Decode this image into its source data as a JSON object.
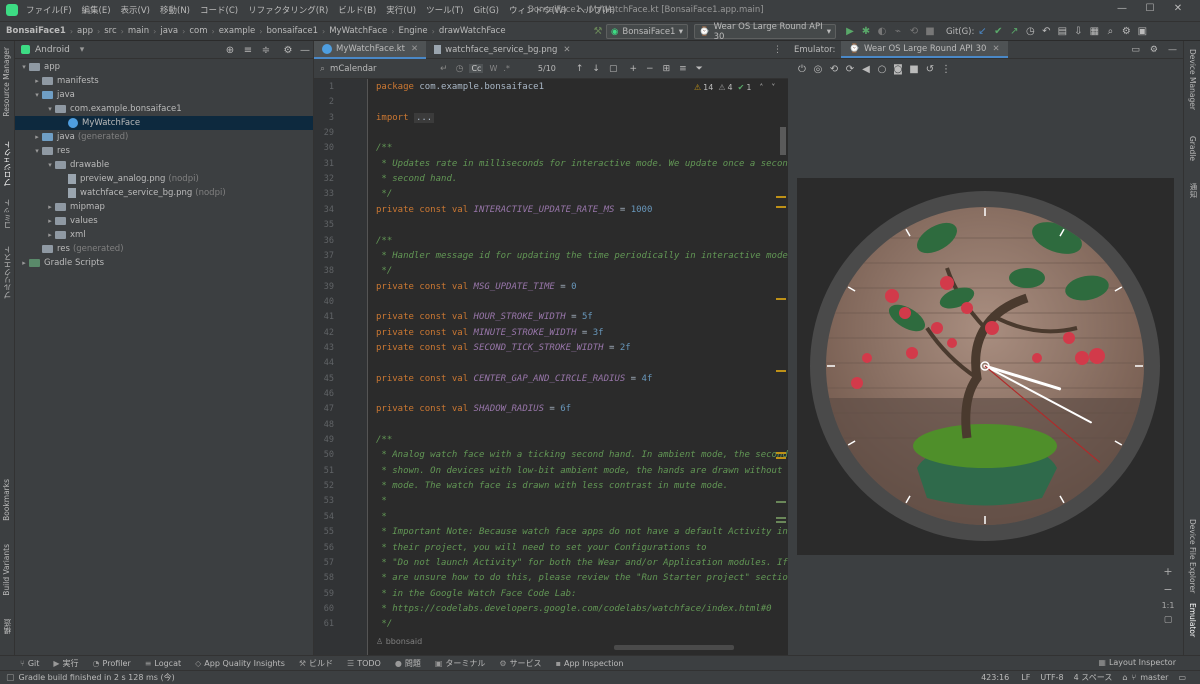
{
  "titlebar": {
    "menu": [
      "ファイル(F)",
      "編集(E)",
      "表示(V)",
      "移動(N)",
      "コード(C)",
      "リファクタリング(R)",
      "ビルド(B)",
      "実行(U)",
      "ツール(T)",
      "Git(G)",
      "ウィンドウ(W)",
      "ヘルプ(H)"
    ],
    "window_title": "BonsaiFace1 - MyWatchFace.kt [BonsaiFace1.app.main]"
  },
  "navbar": {
    "breadcrumbs": [
      "BonsaiFace1",
      "app",
      "src",
      "main",
      "java",
      "com",
      "example",
      "bonsaiface1",
      "MyWatchFace",
      "Engine",
      "drawWatchFace"
    ],
    "run_config": "BonsaiFace1",
    "device": "Wear OS Large Round API 30",
    "git_label": "Git(G):"
  },
  "leftstrip": {
    "items": [
      "Resource Manager",
      "プロジェクト",
      "コミット",
      "プルリクエスト",
      "Bookmarks",
      "Build Variants",
      "構造"
    ]
  },
  "rightstrip": {
    "items": [
      "Device Manager",
      "Gradle",
      "通知",
      "Device File Explorer",
      "Emulator"
    ]
  },
  "project": {
    "view": "Android",
    "tree": [
      {
        "label": "app",
        "suffix": "",
        "indent": 0,
        "arrow": "▾",
        "kind": "folder"
      },
      {
        "label": "manifests",
        "suffix": "",
        "indent": 1,
        "arrow": "▸",
        "kind": "folder"
      },
      {
        "label": "java",
        "suffix": "",
        "indent": 1,
        "arrow": "▾",
        "kind": "folder-blue"
      },
      {
        "label": "com.example.bonsaiface1",
        "suffix": "",
        "indent": 2,
        "arrow": "▾",
        "kind": "folder"
      },
      {
        "label": "MyWatchFace",
        "suffix": "",
        "indent": 3,
        "arrow": "",
        "kind": "kt",
        "selected": true
      },
      {
        "label": "java",
        "suffix": "(generated)",
        "indent": 1,
        "arrow": "▸",
        "kind": "folder-blue"
      },
      {
        "label": "res",
        "suffix": "",
        "indent": 1,
        "arrow": "▾",
        "kind": "folder"
      },
      {
        "label": "drawable",
        "suffix": "",
        "indent": 2,
        "arrow": "▾",
        "kind": "folder"
      },
      {
        "label": "preview_analog.png",
        "suffix": "(nodpi)",
        "indent": 3,
        "arrow": "",
        "kind": "file"
      },
      {
        "label": "watchface_service_bg.png",
        "suffix": "(nodpi)",
        "indent": 3,
        "arrow": "",
        "kind": "file"
      },
      {
        "label": "mipmap",
        "suffix": "",
        "indent": 2,
        "arrow": "▸",
        "kind": "folder"
      },
      {
        "label": "values",
        "suffix": "",
        "indent": 2,
        "arrow": "▸",
        "kind": "folder"
      },
      {
        "label": "xml",
        "suffix": "",
        "indent": 2,
        "arrow": "▸",
        "kind": "folder"
      },
      {
        "label": "res",
        "suffix": "(generated)",
        "indent": 1,
        "arrow": "",
        "kind": "folder"
      },
      {
        "label": "Gradle Scripts",
        "suffix": "",
        "indent": 0,
        "arrow": "▸",
        "kind": "gradle"
      }
    ]
  },
  "editor": {
    "tabs": [
      {
        "label": "MyWatchFace.kt",
        "active": true
      },
      {
        "label": "watchface_service_bg.png",
        "active": false
      }
    ],
    "search": {
      "value": "mCalendar",
      "count": "5/10",
      "cc": "Cc",
      "w": "W"
    },
    "inspections": {
      "warnings": "14",
      "weak": "4",
      "ok": "1"
    },
    "author_hint": "bbonsaid",
    "lines": [
      {
        "n": "1",
        "parts": [
          [
            "kw",
            "package "
          ],
          [
            "pl",
            "com.example.bonsaiface1"
          ]
        ]
      },
      {
        "n": "2",
        "parts": []
      },
      {
        "n": "3",
        "parts": [
          [
            "kw",
            "import "
          ],
          [
            "fd",
            "..."
          ]
        ]
      },
      {
        "n": "29",
        "parts": []
      },
      {
        "n": "30",
        "parts": [
          [
            "cm",
            "/**"
          ]
        ]
      },
      {
        "n": "31",
        "parts": [
          [
            "cm",
            " * Updates rate in milliseconds for interactive mode. We update once a second to advance the"
          ]
        ]
      },
      {
        "n": "32",
        "parts": [
          [
            "cm",
            " * second hand."
          ]
        ]
      },
      {
        "n": "33",
        "parts": [
          [
            "cm",
            " */"
          ]
        ]
      },
      {
        "n": "34",
        "parts": [
          [
            "kw",
            "private const val "
          ],
          [
            "cn",
            "INTERACTIVE_UPDATE_RATE_MS"
          ],
          [
            "pl",
            " = "
          ],
          [
            "num",
            "1000"
          ]
        ]
      },
      {
        "n": "35",
        "parts": []
      },
      {
        "n": "36",
        "parts": [
          [
            "cm",
            "/**"
          ]
        ]
      },
      {
        "n": "37",
        "parts": [
          [
            "cm",
            " * Handler message id for updating the time periodically in interactive mode."
          ]
        ]
      },
      {
        "n": "38",
        "parts": [
          [
            "cm",
            " */"
          ]
        ]
      },
      {
        "n": "39",
        "parts": [
          [
            "kw",
            "private const val "
          ],
          [
            "cn",
            "MSG_UPDATE_TIME"
          ],
          [
            "pl",
            " = "
          ],
          [
            "num",
            "0"
          ]
        ]
      },
      {
        "n": "40",
        "parts": []
      },
      {
        "n": "41",
        "parts": [
          [
            "kw",
            "private const val "
          ],
          [
            "cn",
            "HOUR_STROKE_WIDTH"
          ],
          [
            "pl",
            " = "
          ],
          [
            "num",
            "5f"
          ]
        ]
      },
      {
        "n": "42",
        "parts": [
          [
            "kw",
            "private const val "
          ],
          [
            "cn",
            "MINUTE_STROKE_WIDTH"
          ],
          [
            "pl",
            " = "
          ],
          [
            "num",
            "3f"
          ]
        ]
      },
      {
        "n": "43",
        "parts": [
          [
            "kw",
            "private const val "
          ],
          [
            "cn",
            "SECOND_TICK_STROKE_WIDTH"
          ],
          [
            "pl",
            " = "
          ],
          [
            "num",
            "2f"
          ]
        ]
      },
      {
        "n": "44",
        "parts": []
      },
      {
        "n": "45",
        "parts": [
          [
            "kw",
            "private const val "
          ],
          [
            "cn",
            "CENTER_GAP_AND_CIRCLE_RADIUS"
          ],
          [
            "pl",
            " = "
          ],
          [
            "num",
            "4f"
          ]
        ]
      },
      {
        "n": "46",
        "parts": []
      },
      {
        "n": "47",
        "parts": [
          [
            "kw",
            "private const val "
          ],
          [
            "cn",
            "SHADOW_RADIUS"
          ],
          [
            "pl",
            " = "
          ],
          [
            "num",
            "6f"
          ]
        ]
      },
      {
        "n": "48",
        "parts": []
      },
      {
        "n": "49",
        "parts": [
          [
            "cm",
            "/**"
          ]
        ]
      },
      {
        "n": "50",
        "parts": [
          [
            "cm",
            " * Analog watch face with a ticking second hand. In ambient mode, the second hand isn't"
          ]
        ]
      },
      {
        "n": "51",
        "parts": [
          [
            "cm",
            " * shown. On devices with low-bit ambient mode, the hands are drawn without anti-aliasing in ambient"
          ]
        ]
      },
      {
        "n": "52",
        "parts": [
          [
            "cm",
            " * mode. The watch face is drawn with less contrast in mute mode."
          ]
        ]
      },
      {
        "n": "53",
        "parts": [
          [
            "cm",
            " *"
          ]
        ]
      },
      {
        "n": "54",
        "parts": [
          [
            "cm",
            " *"
          ]
        ]
      },
      {
        "n": "55",
        "parts": [
          [
            "cm",
            " * Important Note: Because watch face apps do not have a default Activity in"
          ]
        ]
      },
      {
        "n": "56",
        "parts": [
          [
            "cm",
            " * their project, you will need to set your Configurations to"
          ]
        ]
      },
      {
        "n": "57",
        "parts": [
          [
            "cm",
            " * \"Do not launch Activity\" for both the Wear and/or Application modules. If you"
          ]
        ]
      },
      {
        "n": "58",
        "parts": [
          [
            "cm",
            " * are unsure how to do this, please review the \"Run Starter project\" section"
          ]
        ]
      },
      {
        "n": "59",
        "parts": [
          [
            "cm",
            " * in the Google Watch Face Code Lab:"
          ]
        ]
      },
      {
        "n": "60",
        "parts": [
          [
            "cm",
            " * https://codelabs.developers.google.com/codelabs/watchface/index.html#0"
          ]
        ]
      },
      {
        "n": "61",
        "parts": [
          [
            "cm",
            " */"
          ]
        ]
      }
    ]
  },
  "emulator": {
    "label": "Emulator:",
    "tab": "Wear OS Large Round API 30",
    "zoom_ratio": "1:1"
  },
  "bottombar": {
    "tabs": [
      {
        "icon": "⑂",
        "label": "Git"
      },
      {
        "icon": "▶",
        "label": "実行"
      },
      {
        "icon": "◔",
        "label": "Profiler"
      },
      {
        "icon": "≡",
        "label": "Logcat"
      },
      {
        "icon": "◇",
        "label": "App Quality Insights"
      },
      {
        "icon": "⚒",
        "label": "ビルド"
      },
      {
        "icon": "☰",
        "label": "TODO"
      },
      {
        "icon": "●",
        "label": "問題"
      },
      {
        "icon": "▣",
        "label": "ターミナル"
      },
      {
        "icon": "⚙",
        "label": "サービス"
      },
      {
        "icon": "▪",
        "label": "App Inspection"
      }
    ],
    "layout_inspector": "Layout Inspector"
  },
  "statusbar": {
    "message": "Gradle build finished in 2 s 128 ms (今)",
    "position": "423:16",
    "line_sep": "LF",
    "encoding": "UTF-8",
    "indent": "4 スペース",
    "branch": "master"
  },
  "watch": {
    "hour_hand_deg": 107,
    "minute_hand_deg": 118,
    "second_hand_deg": 130
  }
}
